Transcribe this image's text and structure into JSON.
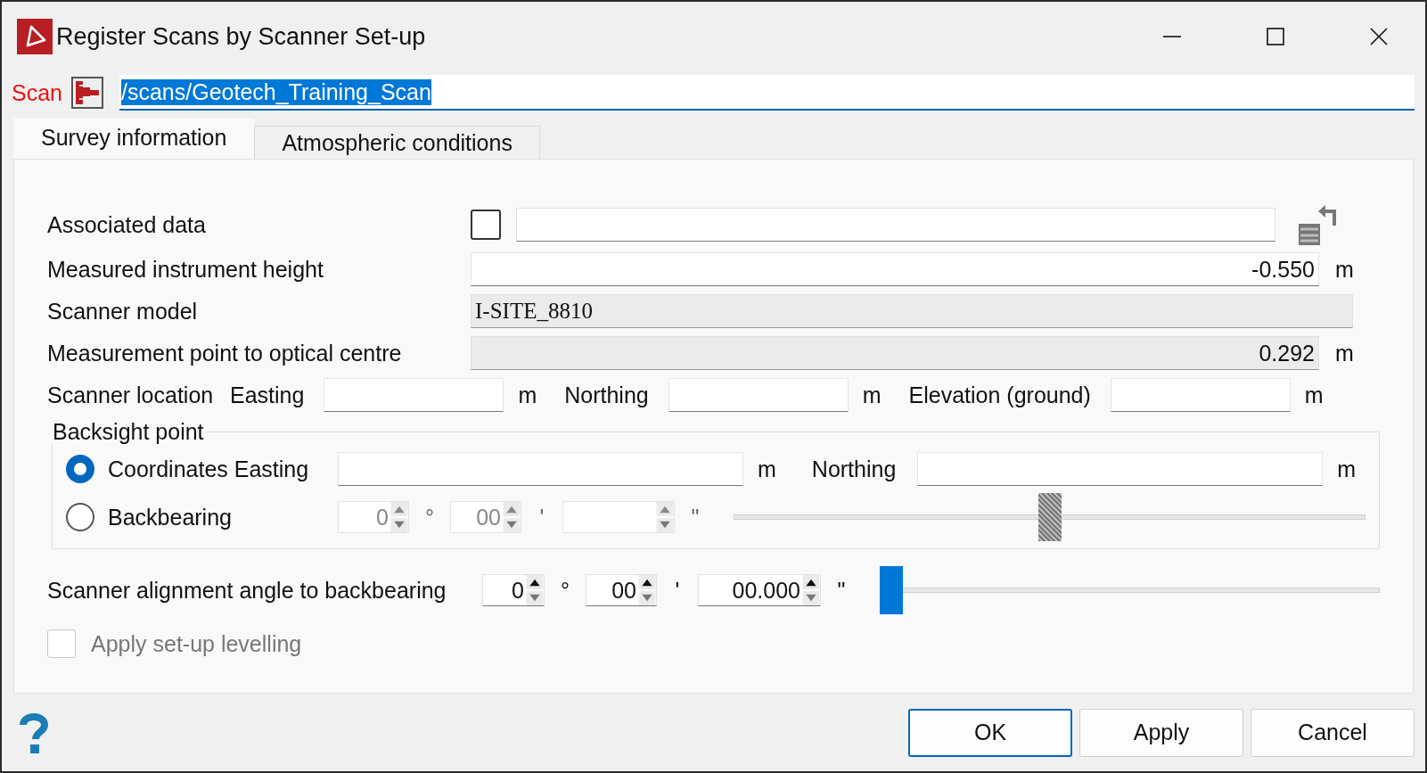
{
  "window": {
    "title": "Register Scans by Scanner Set-up"
  },
  "scan": {
    "label": "Scan",
    "value": "/scans/Geotech_Training_Scan",
    "text_selected": true
  },
  "tabs": [
    {
      "label": "Survey information",
      "selected": true
    },
    {
      "label": "Atmospheric conditions",
      "selected": false
    }
  ],
  "associated_data": {
    "label": "Associated data",
    "checked": false
  },
  "instrument_height": {
    "label": "Measured instrument height",
    "value": "-0.550",
    "unit": "m"
  },
  "scanner_model": {
    "label": "Scanner model",
    "value": "I-SITE_8810"
  },
  "optical_centre": {
    "label": "Measurement point to optical centre",
    "value": "0.292",
    "unit": "m"
  },
  "scanner_location": {
    "label": "Scanner location",
    "fields": [
      {
        "label": "Easting",
        "unit": "m"
      },
      {
        "label": "Northing",
        "unit": "m"
      },
      {
        "label": "Elevation (ground)",
        "unit": "m"
      }
    ]
  },
  "backsight": {
    "title": "Backsight point",
    "options": [
      {
        "label": "Coordinates Easting",
        "selected": true
      },
      {
        "label": "Backbearing",
        "selected": false
      }
    ],
    "easting_unit": "m",
    "northing_label": "Northing",
    "northing_unit": "m",
    "bearing": {
      "disabled": true,
      "degrees": "0",
      "deg_sym": "°",
      "minutes": "00",
      "min_sym": "'",
      "sec_sym": "\"",
      "level": 0.5
    }
  },
  "alignment": {
    "label": "Scanner alignment angle to backbearing",
    "degrees": "0",
    "deg_sym": "°",
    "minutes": "00",
    "min_sym": "'",
    "seconds": "00.000",
    "sec_sym": "\"",
    "level": 0
  },
  "levelling": {
    "label": "Apply set-up levelling",
    "checked": false,
    "disabled": true
  },
  "buttons": [
    {
      "label": "OK",
      "default": true
    },
    {
      "label": "Apply",
      "default": false
    },
    {
      "label": "Cancel",
      "default": false
    }
  ]
}
